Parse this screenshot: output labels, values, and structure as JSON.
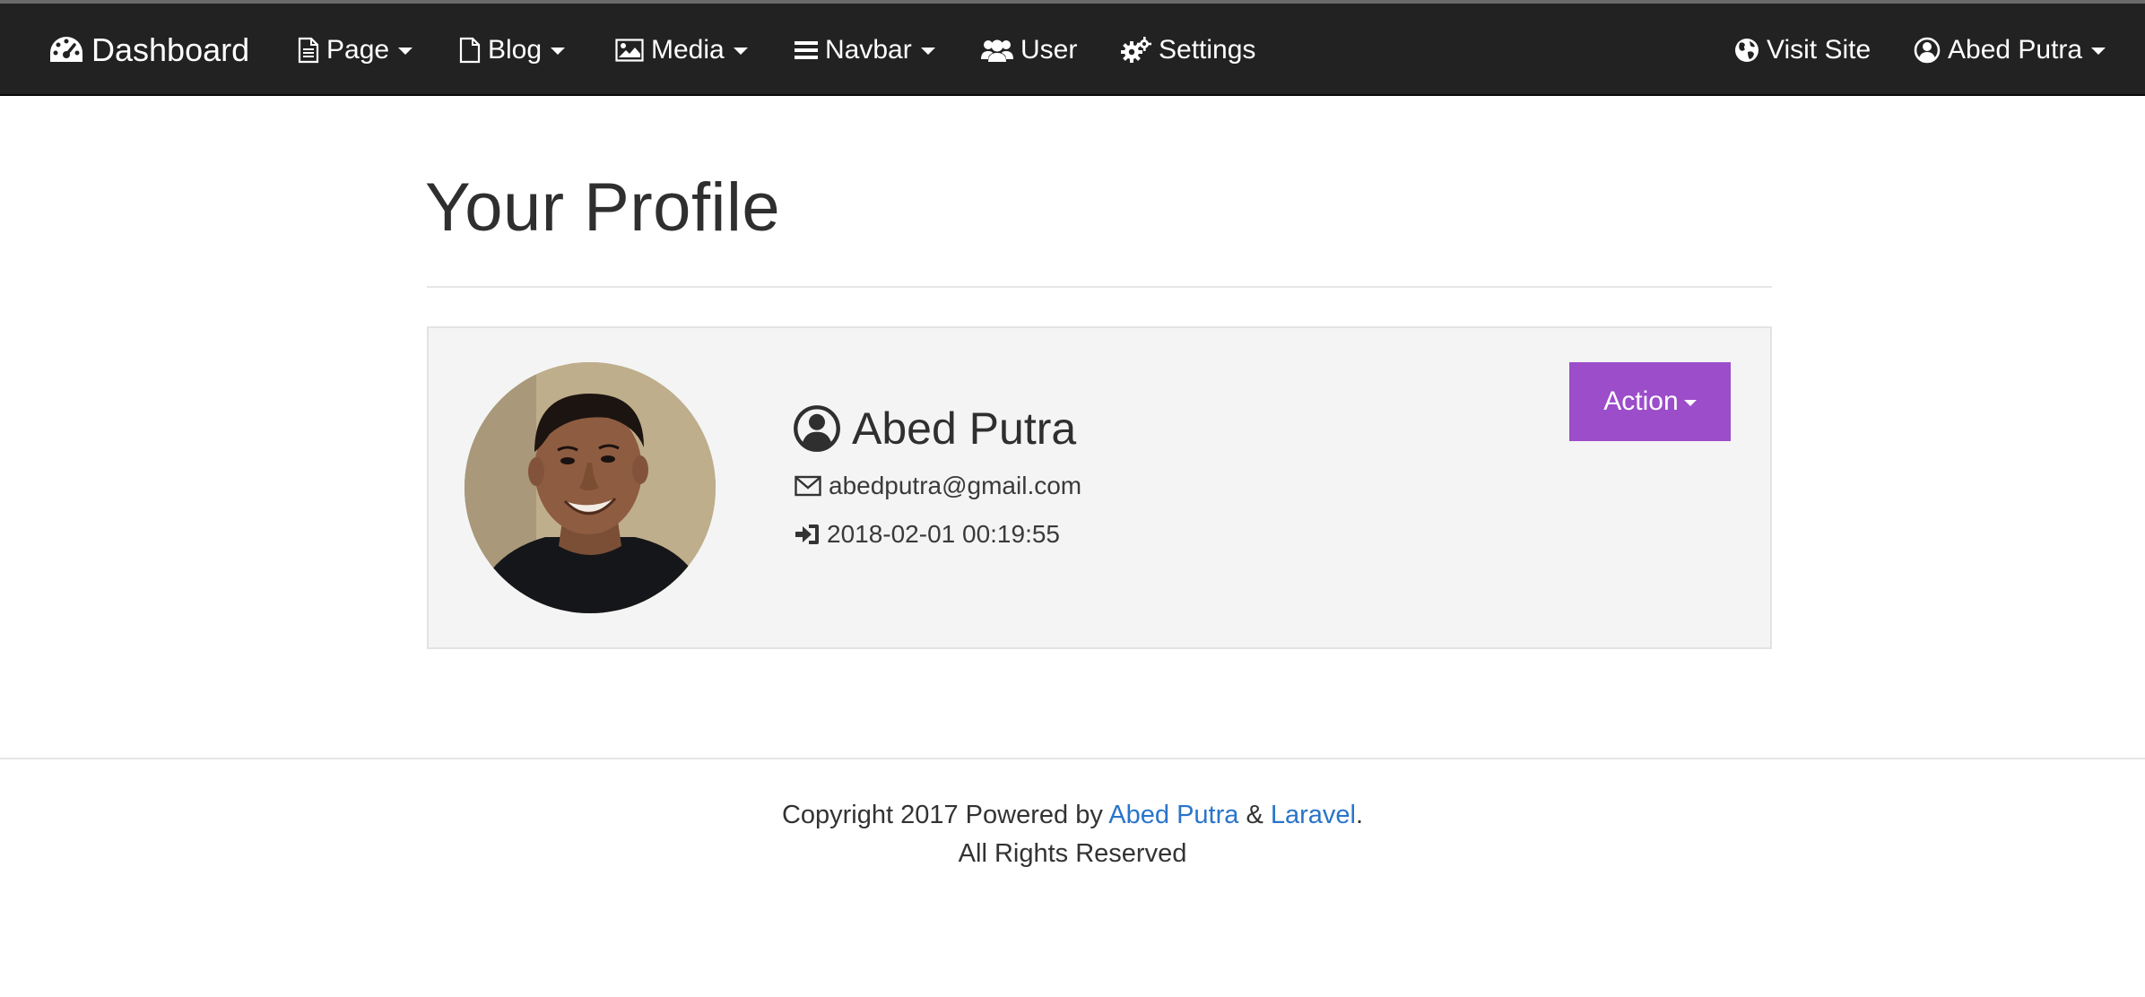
{
  "navbar": {
    "brand": "Dashboard",
    "items": [
      {
        "label": "Page",
        "icon": "file-text-icon",
        "dropdown": true
      },
      {
        "label": "Blog",
        "icon": "file-icon",
        "dropdown": true
      },
      {
        "label": "Media",
        "icon": "image-icon",
        "dropdown": true
      },
      {
        "label": "Navbar",
        "icon": "bars-icon",
        "dropdown": true
      },
      {
        "label": "User",
        "icon": "users-icon",
        "dropdown": false
      },
      {
        "label": "Settings",
        "icon": "gears-icon",
        "dropdown": false
      }
    ],
    "right": {
      "visit_site": "Visit Site",
      "user_menu": "Abed Putra"
    }
  },
  "page": {
    "title": "Your Profile"
  },
  "profile": {
    "name": "Abed Putra",
    "email": "abedputra@gmail.com",
    "last_login": "2018-02-01 00:19:55",
    "action_label": "Action"
  },
  "footer": {
    "prefix": "Copyright 2017 Powered by ",
    "author_link": "Abed Putra",
    "amp": " & ",
    "framework_link": "Laravel",
    "period": ".",
    "rights": "All Rights Reserved"
  },
  "colors": {
    "navbar_bg": "#222222",
    "action_button": "#9b4dca",
    "link": "#2a74c9",
    "panel_bg": "#f4f4f4"
  }
}
